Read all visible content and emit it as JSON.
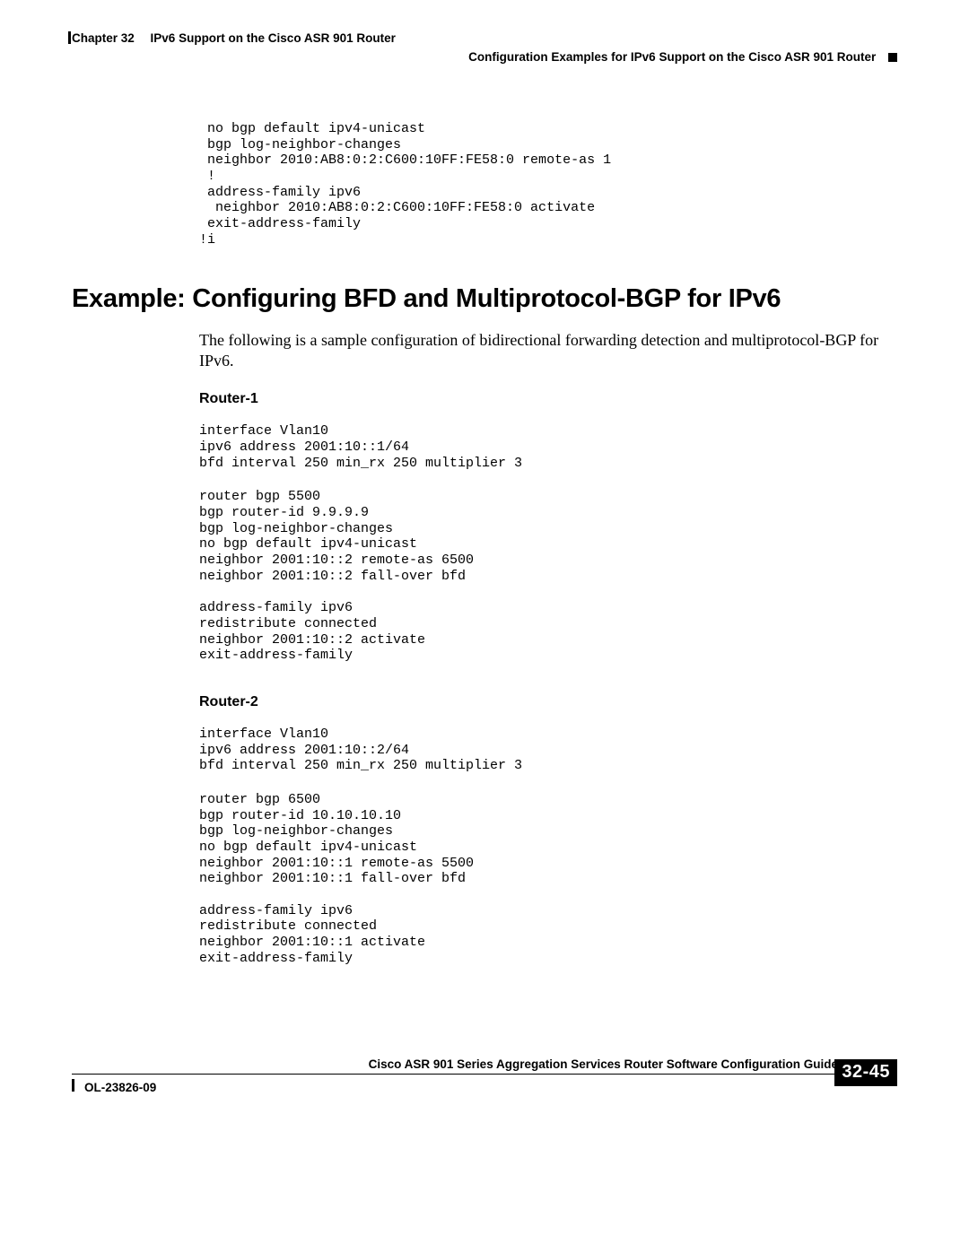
{
  "header": {
    "chapter_label": "Chapter 32",
    "chapter_title": "IPv6 Support on the Cisco ASR 901 Router",
    "section_nav": "Configuration Examples for IPv6 Support on the Cisco ASR 901 Router"
  },
  "code_top": " no bgp default ipv4-unicast\n bgp log-neighbor-changes\n neighbor 2010:AB8:0:2:C600:10FF:FE58:0 remote-as 1\n !\n address-family ipv6\n  neighbor 2010:AB8:0:2:C600:10FF:FE58:0 activate\n exit-address-family\n!i",
  "section": {
    "title": "Example: Configuring BFD and Multiprotocol-BGP for IPv6",
    "intro": "The following is a sample configuration of bidirectional forwarding detection and multiprotocol-BGP for IPv6."
  },
  "router1": {
    "label": "Router-1",
    "block_a": "interface Vlan10\nipv6 address 2001:10::1/64\nbfd interval 250 min_rx 250 multiplier 3",
    "block_b": "router bgp 5500\nbgp router-id 9.9.9.9\nbgp log-neighbor-changes\nno bgp default ipv4-unicast\nneighbor 2001:10::2 remote-as 6500\nneighbor 2001:10::2 fall-over bfd\n\naddress-family ipv6\nredistribute connected\nneighbor 2001:10::2 activate\nexit-address-family"
  },
  "router2": {
    "label": "Router-2",
    "block_a": "interface Vlan10\nipv6 address 2001:10::2/64\nbfd interval 250 min_rx 250 multiplier 3",
    "block_b": "router bgp 6500\nbgp router-id 10.10.10.10\nbgp log-neighbor-changes\nno bgp default ipv4-unicast\nneighbor 2001:10::1 remote-as 5500\nneighbor 2001:10::1 fall-over bfd\n\naddress-family ipv6\nredistribute connected\nneighbor 2001:10::1 activate\nexit-address-family"
  },
  "footer": {
    "guide_title": "Cisco ASR 901 Series Aggregation Services Router Software Configuration Guide",
    "doc_id": "OL-23826-09",
    "page_number": "32-45"
  }
}
